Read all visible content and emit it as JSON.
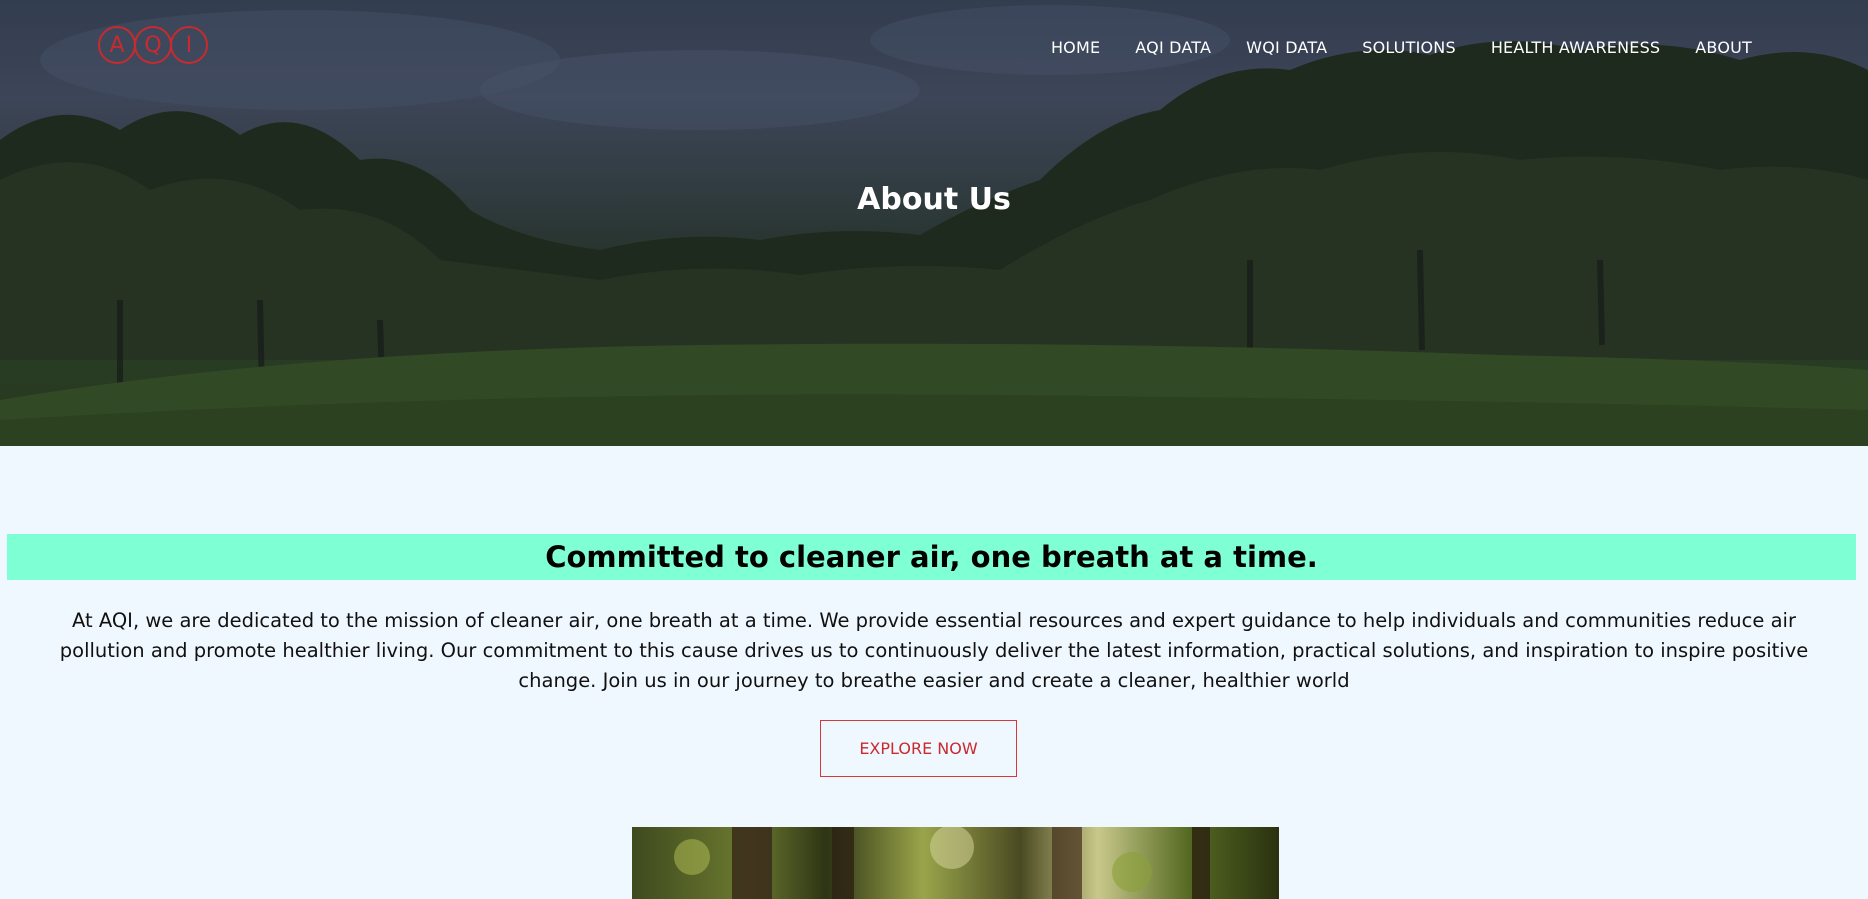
{
  "header": {
    "logo_letters": [
      "A",
      "Q",
      "I"
    ],
    "nav": [
      "HOME",
      "AQI DATA",
      "WQI DATA",
      "SOLUTIONS",
      "HEALTH AWARENESS",
      "ABOUT"
    ]
  },
  "hero": {
    "title": "About Us"
  },
  "mission": {
    "heading": "Committed to cleaner air, one breath at a time.",
    "body": "At AQI, we are dedicated to the mission of cleaner air, one breath at a time. We provide essential resources and expert guidance to help individuals and communities reduce air pollution and promote healthier living. Our commitment to this cause drives us to continuously deliver the latest information, practical solutions, and inspiration to inspire positive change. Join us in our journey to breathe easier and create a cleaner, healthier world",
    "button": "EXPLORE NOW"
  },
  "colors": {
    "brand_red": "#c82a2e",
    "band_aquamarine": "#7fffd4",
    "page_bg": "#f0f8ff"
  }
}
